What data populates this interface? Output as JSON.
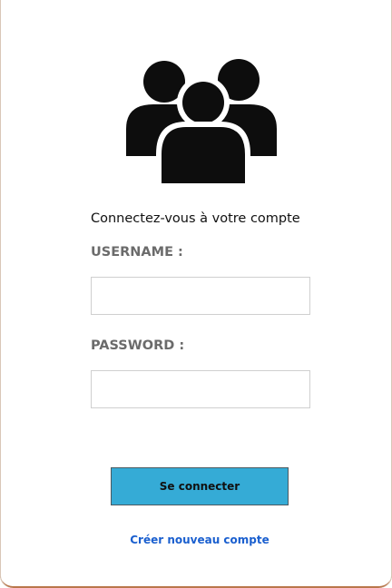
{
  "login": {
    "logo_icon": "users-group-icon",
    "subtitle": "Connectez-vous à votre compte",
    "username_label": "USERNAME :",
    "username_value": "",
    "password_label": "PASSWORD :",
    "password_value": "",
    "submit_label": "Se connecter",
    "create_account_label": "Créer nouveau compte"
  },
  "colors": {
    "button_bg": "#35abd6",
    "link": "#1a5fcf",
    "label": "#6b6b6b",
    "input_border": "#cfcfcf"
  }
}
